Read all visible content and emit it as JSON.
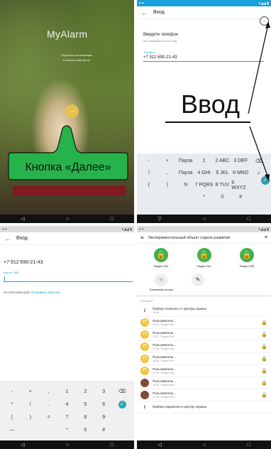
{
  "panel1": {
    "logo": "MyAlarm",
    "tagline": [
      "Охранная сигнализация",
      "в вашем смартфоне"
    ],
    "next_glyph": "→",
    "callout": "Кнопка «Далее»"
  },
  "panel2": {
    "title": "Вход",
    "heading": "Введите телефон",
    "subheading": "Мы отправим на него код",
    "field_label": "Телефон",
    "field_value": "+7 912 690-21-43",
    "overlay": "Ввод",
    "keys": [
      "-",
      "+",
      "Пауза",
      "1",
      "2 ABC",
      "3 DEF",
      "⌫",
      "/",
      ",",
      "Пауза",
      "4 GHI",
      "5 JKL",
      "6 MNO",
      "✓",
      "(",
      ")",
      "N",
      "7 PQRS",
      "8 TUV",
      "9 WXYZ",
      "",
      ".",
      "",
      "",
      "*",
      "0",
      "#",
      ""
    ]
  },
  "panel3": {
    "title": "Вход",
    "phone": "+7 912 690-21-43",
    "field_label": "Код из SMS",
    "resend_text": "Не получили код?",
    "resend_link": "Отправить ещё раз",
    "keys": [
      "-",
      "+",
      ",",
      "1",
      "2",
      "3",
      "⌫",
      "*",
      "/",
      ".",
      "4",
      "5",
      "6",
      "✓",
      "(",
      ")",
      "=",
      "7",
      "8",
      "9",
      "",
      "—",
      "",
      "",
      "*",
      "0",
      "#",
      ""
    ]
  },
  "panel4": {
    "title": "Экспериментальный объект отдела развития",
    "sections": [
      "Раздел №1",
      "Раздел №2",
      "Раздел №3"
    ],
    "alarm_button": "Тревожная кнопка",
    "today": "Сегодня",
    "events": [
      {
        "icon": "i",
        "title": "Прибор отключен от Центра охраны",
        "sub": "11:56",
        "lock": ""
      },
      {
        "icon": "П",
        "title": "Пользователь...",
        "sub": "11:57, Раздел №1",
        "lock": "g"
      },
      {
        "icon": "П",
        "title": "Пользователь...",
        "sub": "11:57, Раздел №2",
        "lock": "o"
      },
      {
        "icon": "П",
        "title": "Пользователь...",
        "sub": "11:56, Раздел №1",
        "lock": "g"
      },
      {
        "icon": "П",
        "title": "Пользователь...",
        "sub": "11:56, Раздел №1",
        "lock": "o"
      },
      {
        "icon": "П",
        "title": "Пользователь...",
        "sub": "11:56, Раздел №2",
        "lock": "o"
      },
      {
        "icon": "av",
        "title": "Пользователь...",
        "sub": "11:55, Раздел №1",
        "lock": "g"
      },
      {
        "icon": "av",
        "title": "Пользователь...",
        "sub": "11:55, Раздел №1",
        "lock": "o"
      },
      {
        "icon": "i",
        "title": "Прибор подключен к Центру охраны",
        "sub": "",
        "lock": ""
      }
    ]
  },
  "colors": {
    "accent": "#1aa0d8",
    "green": "#3fb24a",
    "yellow": "#f2c443",
    "callout": "#27b34b"
  }
}
